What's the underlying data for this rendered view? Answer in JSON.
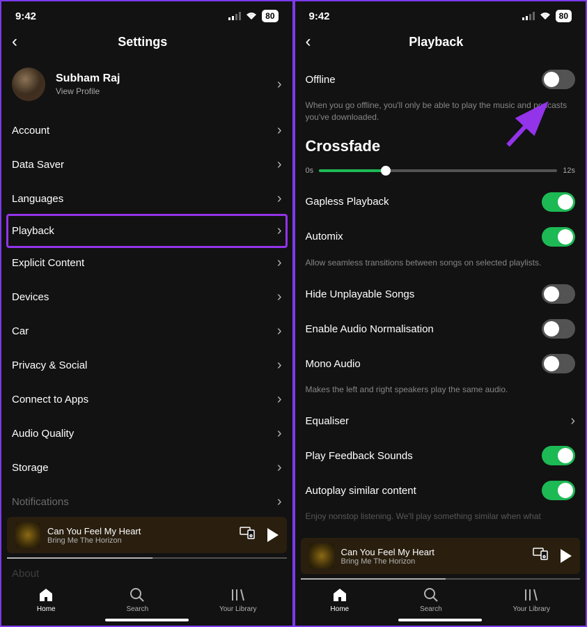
{
  "statusBar": {
    "time": "9:42",
    "battery": "80"
  },
  "left": {
    "title": "Settings",
    "profile": {
      "name": "Subham Raj",
      "sub": "View Profile"
    },
    "menu": [
      {
        "label": "Account",
        "highlighted": false
      },
      {
        "label": "Data Saver",
        "highlighted": false
      },
      {
        "label": "Languages",
        "highlighted": false
      },
      {
        "label": "Playback",
        "highlighted": true
      },
      {
        "label": "Explicit Content",
        "highlighted": false
      },
      {
        "label": "Devices",
        "highlighted": false
      },
      {
        "label": "Car",
        "highlighted": false
      },
      {
        "label": "Privacy & Social",
        "highlighted": false
      },
      {
        "label": "Connect to Apps",
        "highlighted": false
      },
      {
        "label": "Audio Quality",
        "highlighted": false
      },
      {
        "label": "Storage",
        "highlighted": false
      },
      {
        "label": "Notifications",
        "highlighted": false,
        "dim": true
      }
    ],
    "partialBottom": "About"
  },
  "right": {
    "title": "Playback",
    "offline": {
      "label": "Offline",
      "help": "When you go offline, you'll only be able to play the music and podcasts you've downloaded.",
      "on": false
    },
    "crossfade": {
      "title": "Crossfade",
      "minLabel": "0s",
      "maxLabel": "12s",
      "percent": 28
    },
    "toggles": [
      {
        "label": "Gapless Playback",
        "on": true
      },
      {
        "label": "Automix",
        "on": true,
        "help": "Allow seamless transitions between songs on selected playlists."
      },
      {
        "label": "Hide Unplayable Songs",
        "on": false
      },
      {
        "label": "Enable Audio Normalisation",
        "on": false
      },
      {
        "label": "Mono Audio",
        "on": false,
        "help": "Makes the left and right speakers play the same audio."
      }
    ],
    "equaliser": "Equaliser",
    "bottomToggles": [
      {
        "label": "Play Feedback Sounds",
        "on": true
      },
      {
        "label": "Autoplay similar content",
        "on": true
      }
    ],
    "partialHelp": "Enjoy nonstop listening. We'll play something similar when what"
  },
  "nowPlaying": {
    "title": "Can You Feel My Heart",
    "artist": "Bring Me The Horizon"
  },
  "tabs": {
    "home": "Home",
    "search": "Search",
    "library": "Your Library"
  }
}
